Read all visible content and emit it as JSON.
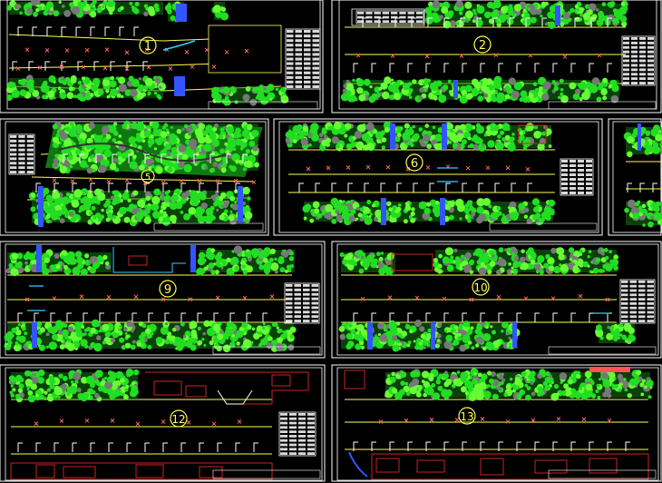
{
  "sheets": [
    {
      "id": "s1",
      "number": "1"
    },
    {
      "id": "s2",
      "number": "2"
    },
    {
      "id": "s5",
      "number": "5"
    },
    {
      "id": "s6",
      "number": "6"
    },
    {
      "id": "s7",
      "number": ""
    },
    {
      "id": "s9",
      "number": "9"
    },
    {
      "id": "s10",
      "number": "10"
    },
    {
      "id": "s12",
      "number": "12"
    },
    {
      "id": "s13",
      "number": "13"
    }
  ],
  "colors": {
    "background": "#000000",
    "frame": "#ffffff",
    "road_line": "#ffff55",
    "vegetation": "#22dd22",
    "vegetation_light": "#66ff33",
    "vegetation_dark": "#117711",
    "planting_marker": "#ff6666",
    "pole_marker": "#ffffff",
    "crossing": "#3355ff",
    "building": "#cc2222",
    "path": "#33ccff"
  }
}
